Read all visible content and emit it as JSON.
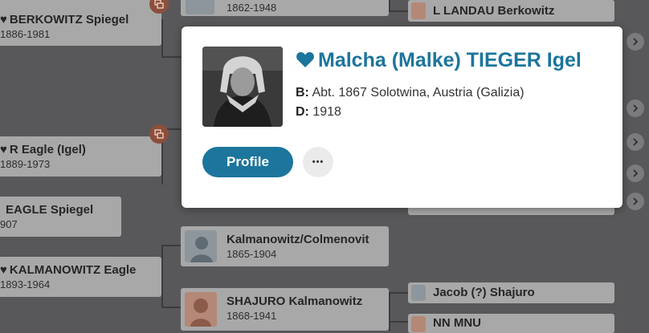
{
  "tree": {
    "cards": [
      {
        "id": "berkowitz",
        "name": "BERKOWITZ Spiegel",
        "dates": "1886-1981",
        "heart": true
      },
      {
        "id": "eagle-igel",
        "name": "R Eagle (Igel)",
        "dates": "1889-1973",
        "heart": true
      },
      {
        "id": "eagle-spiegel",
        "name": "EAGLE Spiegel",
        "dates": "907",
        "heart": false
      },
      {
        "id": "kalmanowitz-eagle",
        "name": "KALMANOWITZ Eagle",
        "dates": "1893-1964",
        "heart": true
      },
      {
        "id": "top-middle",
        "name": "",
        "dates": "1862-1948",
        "heart": false
      },
      {
        "id": "kalmanowitz-colmenovit",
        "name": "Kalmanowitz/Colmenovit",
        "dates": "1865-1904",
        "heart": false
      },
      {
        "id": "shajuro-kalmanowitz",
        "name": "SHAJURO Kalmanowitz",
        "dates": "1868-1941",
        "heart": false
      },
      {
        "id": "landau",
        "name": "L LANDAU Berkowitz",
        "dates": "",
        "heart": false
      },
      {
        "id": "jacob-shajuro",
        "name": "Jacob (?) Shajuro",
        "dates": "",
        "heart": false
      },
      {
        "id": "nn-mnu",
        "name": "NN MNU",
        "dates": "",
        "heart": false
      }
    ]
  },
  "popup": {
    "name": "Malcha (Malke) TIEGER Igel",
    "birth_label": "B:",
    "birth_value": "Abt. 1867 Solotwina, Austria (Galizia)",
    "death_label": "D:",
    "death_value": "1918",
    "profile_label": "Profile",
    "more_label": "•••"
  },
  "colors": {
    "accent": "#1c759c",
    "background": "#58585a",
    "card": "#a8a8a9",
    "hint": "#8b4f3b"
  }
}
